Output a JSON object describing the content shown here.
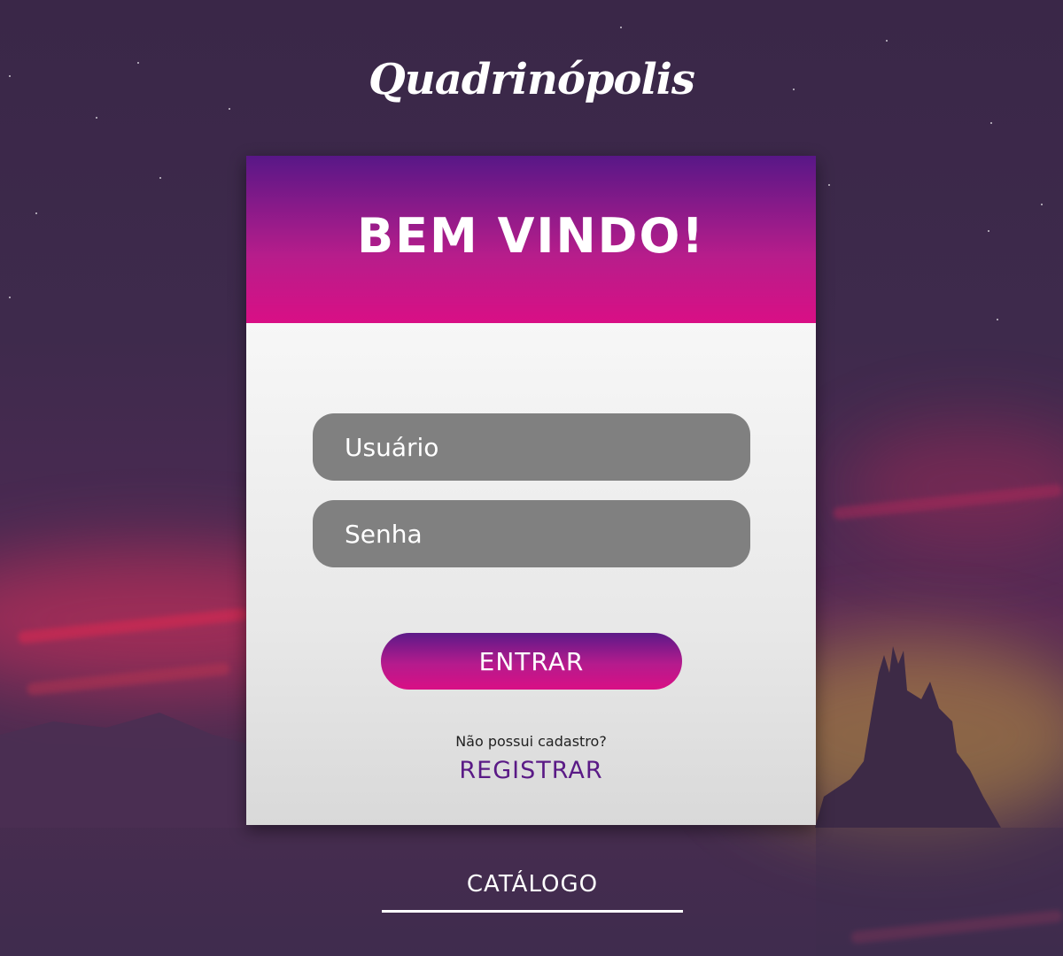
{
  "logo": {
    "text": "Quadrinópolis"
  },
  "login_card": {
    "title": "BEM VINDO!",
    "username": {
      "placeholder": "Usuário",
      "value": ""
    },
    "password": {
      "placeholder": "Senha",
      "value": ""
    },
    "submit_label": "ENTRAR",
    "no_account_text": "Não possui cadastro?",
    "register_label": "REGISTRAR"
  },
  "footer": {
    "catalog_label": "CATÁLOGO"
  },
  "colors": {
    "background": "#3e2a4c",
    "header_gradient_top": "#581787",
    "header_gradient_bottom": "#d90f85",
    "field_background": "#808080",
    "register_link": "#5a1a86"
  }
}
